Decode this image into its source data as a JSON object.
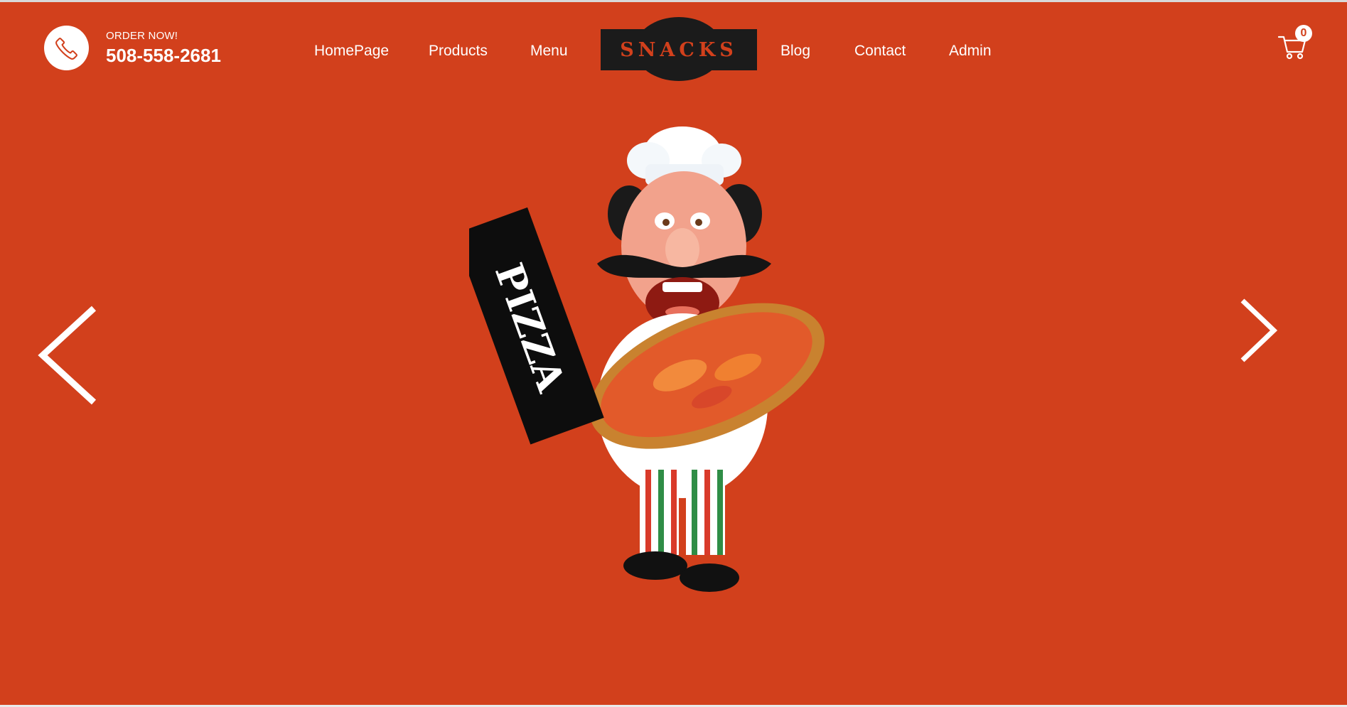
{
  "header": {
    "order_label": "ORDER NOW!",
    "phone": "508-558-2681",
    "nav_left": [
      "HomePage",
      "Products",
      "Menu"
    ],
    "nav_right": [
      "Blog",
      "Contact",
      "Admin"
    ],
    "logo_text": "SNACKS",
    "cart_count": "0"
  },
  "hero": {
    "sign_text": "PIZZA"
  },
  "colors": {
    "background": "#d2401c",
    "text": "#ffffff",
    "logo_bg": "#1b1b1b"
  },
  "icons": [
    "phone-icon",
    "cart-icon",
    "chevron-left-icon",
    "chevron-right-icon"
  ]
}
